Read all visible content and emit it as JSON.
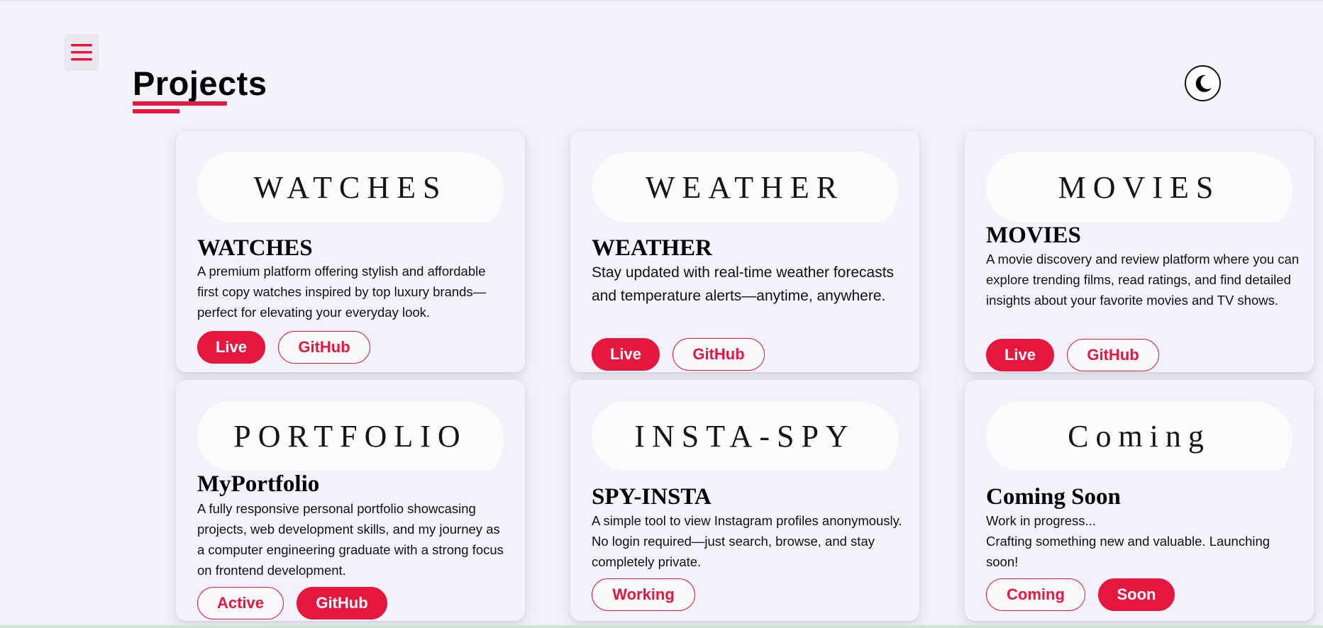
{
  "header": {
    "title": "Projects",
    "menu_icon": "hamburger-menu-icon",
    "theme_icon": "moon-icon"
  },
  "colors": {
    "accent": "#e5173f",
    "background": "#f3f2fa",
    "banner": "#fbfbfe"
  },
  "projects": [
    {
      "banner": "WATCHES",
      "title": "WATCHES",
      "description": "A premium platform offering stylish and affordable first copy watches inspired by top luxury brands—perfect for elevating your everyday look.",
      "buttons": [
        {
          "label": "Live",
          "style": "filled"
        },
        {
          "label": "GitHub",
          "style": "outline"
        }
      ]
    },
    {
      "banner": "WEATHER",
      "title": "WEATHER",
      "description": "Stay updated with real-time weather forecasts and temperature alerts—anytime, anywhere.",
      "buttons": [
        {
          "label": "Live",
          "style": "filled"
        },
        {
          "label": "GitHub",
          "style": "outline"
        }
      ]
    },
    {
      "banner": "MOVIES",
      "title": "MOVIES",
      "description": "A movie discovery and review platform where you can explore trending films, read ratings, and find detailed insights about your favorite movies and TV shows.",
      "buttons": [
        {
          "label": "Live",
          "style": "filled"
        },
        {
          "label": "GitHub",
          "style": "outline"
        }
      ]
    },
    {
      "banner": "PORTFOLIO",
      "title": "MyPortfolio",
      "description": "A fully responsive personal portfolio showcasing projects, web development skills, and my journey as a computer engineering graduate with a strong focus on frontend development.",
      "buttons": [
        {
          "label": "Active",
          "style": "outline"
        },
        {
          "label": "GitHub",
          "style": "filled"
        }
      ]
    },
    {
      "banner": "INSTA-SPY",
      "title": "SPY-INSTA",
      "description": "A simple tool to view Instagram profiles anonymously. No login required—just search, browse, and stay completely private.",
      "buttons": [
        {
          "label": "Working",
          "style": "outline"
        }
      ]
    },
    {
      "banner": "Coming",
      "title": "Coming Soon",
      "description_line1": "Work in progress...",
      "description": "Crafting something new and valuable. Launching soon!",
      "buttons": [
        {
          "label": "Coming",
          "style": "outline"
        },
        {
          "label": "Soon",
          "style": "filled"
        }
      ]
    }
  ]
}
